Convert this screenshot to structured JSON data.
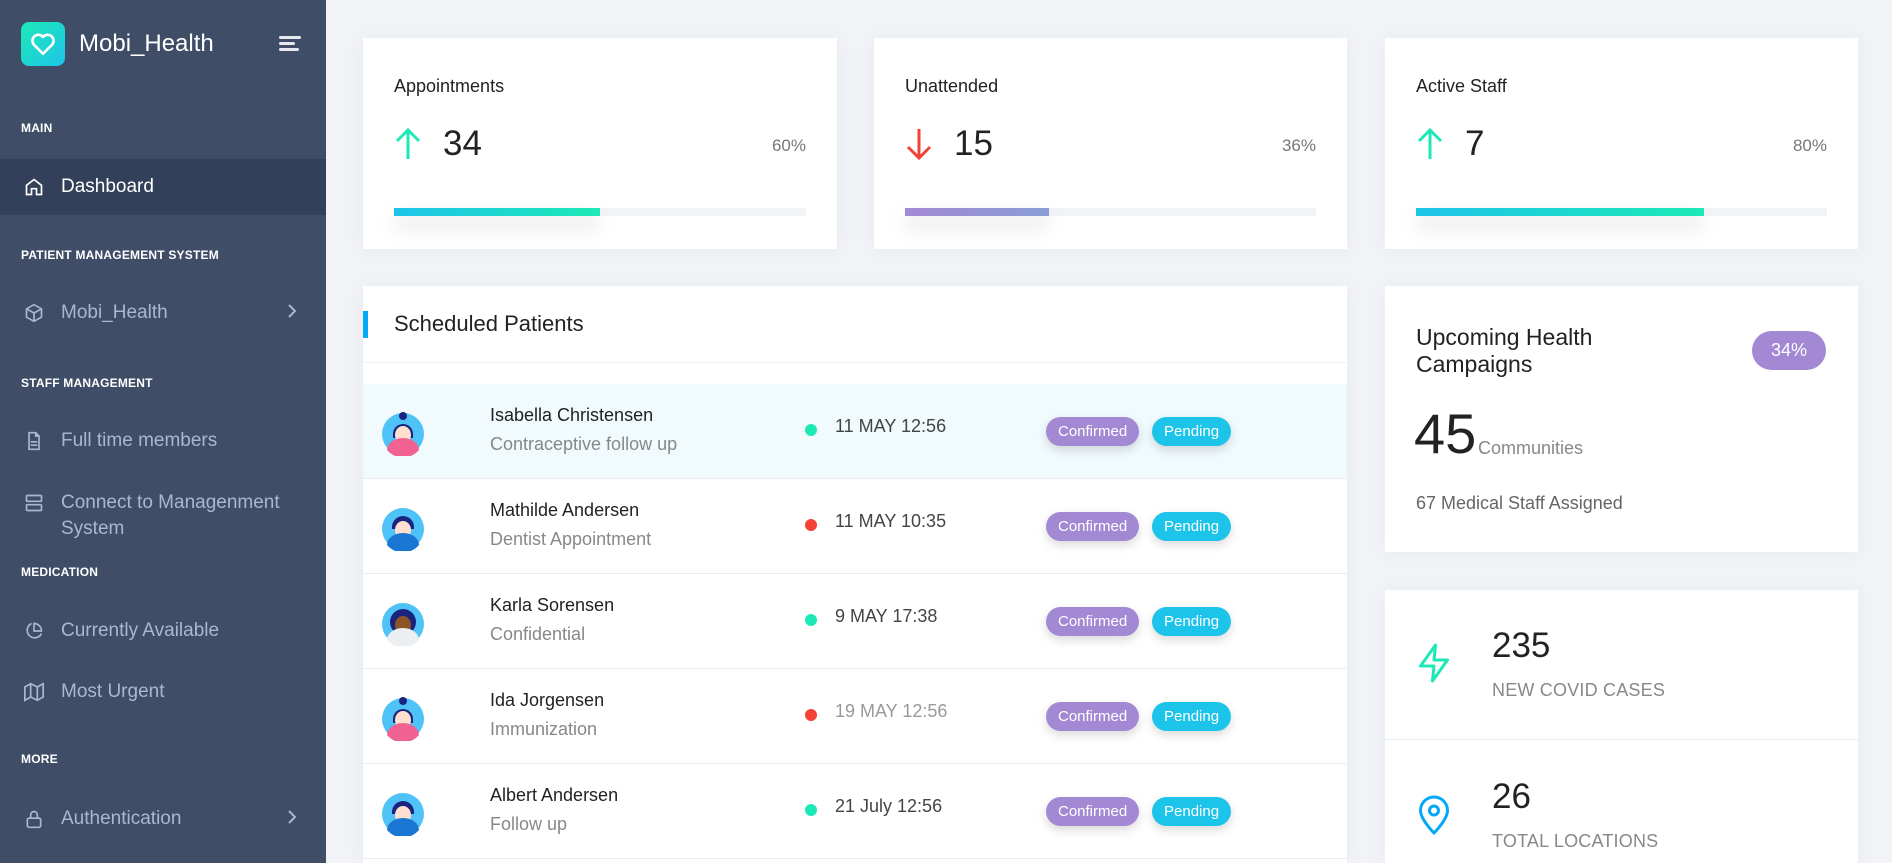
{
  "sidebar": {
    "brand": "Mobi_Health",
    "sections": {
      "main": "MAIN",
      "pms": "PATIENT MANAGEMENT SYSTEM",
      "staff": "STAFF MANAGEMENT",
      "medication": "MEDICATION",
      "more": "MORE"
    },
    "items": {
      "dashboard": "Dashboard",
      "mobi_health": "Mobi_Health",
      "full_time": "Full time members",
      "connect_line1": "Connect to Managenment",
      "connect_line2": "System",
      "currently_available": "Currently Available",
      "most_urgent": "Most Urgent",
      "authentication": "Authentication"
    }
  },
  "stats": [
    {
      "title": "Appointments",
      "value": "34",
      "percent": "60%",
      "progress": 0.5,
      "trend": "up"
    },
    {
      "title": "Unattended",
      "value": "15",
      "percent": "36%",
      "progress": 0.35,
      "trend": "down"
    },
    {
      "title": "Active Staff",
      "value": "7",
      "percent": "80%",
      "progress": 0.7,
      "trend": "up"
    }
  ],
  "patients": {
    "title": "Scheduled Patients",
    "confirmed_label": "Confirmed",
    "pending_label": "Pending",
    "rows": [
      {
        "name": "Isabella Christensen",
        "reason": "Contraceptive follow up",
        "date": "11 MAY 12:56",
        "status_color": "#1de9b6"
      },
      {
        "name": "Mathilde Andersen",
        "reason": "Dentist Appointment",
        "date": "11 MAY 10:35",
        "status_color": "#f44236"
      },
      {
        "name": "Karla Sorensen",
        "reason": "Confidential",
        "date": "9 MAY 17:38",
        "status_color": "#1de9b6"
      },
      {
        "name": "Ida Jorgensen",
        "reason": "Immunization",
        "date": "19 MAY 12:56",
        "status_color": "#f44236"
      },
      {
        "name": "Albert Andersen",
        "reason": "Follow up",
        "date": "21 July 12:56",
        "status_color": "#1de9b6"
      }
    ]
  },
  "campaigns": {
    "title": "Upcoming Health Campaigns",
    "badge": "34%",
    "count": "45",
    "unit": "Communities",
    "staff": "67 Medical Staff Assigned"
  },
  "metrics": [
    {
      "value": "235",
      "label": "NEW COVID CASES",
      "icon": "zap-icon"
    },
    {
      "value": "26",
      "label": "TOTAL LOCATIONS",
      "icon": "map-pin-icon"
    }
  ]
}
